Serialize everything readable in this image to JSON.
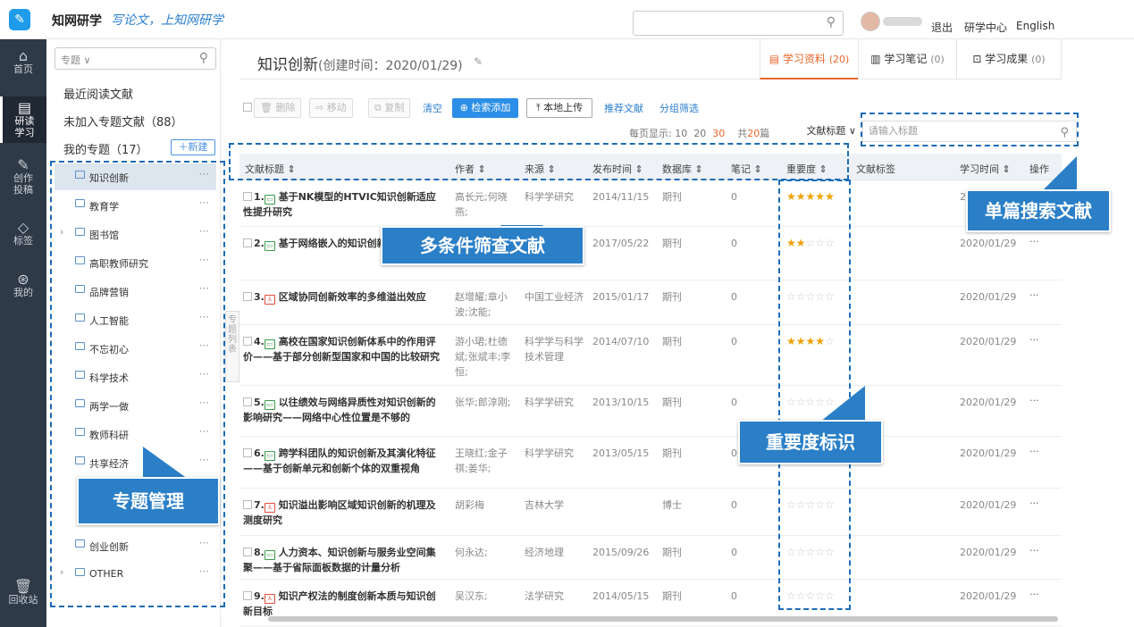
{
  "topbar": {
    "brand": "知网研学",
    "slogan": "写论文，上知网研学",
    "logout": "退出",
    "research_center": "研学中心",
    "language": "English"
  },
  "leftnav": [
    {
      "label": "首页",
      "icon": "home-icon"
    },
    {
      "label": "研读学习",
      "icon": "book-icon"
    },
    {
      "label": "创作投稿",
      "icon": "edit-icon"
    },
    {
      "label": "标签",
      "icon": "tag-icon"
    },
    {
      "label": "我的",
      "icon": "user-icon"
    },
    {
      "label": "回收站",
      "icon": "trash-icon"
    }
  ],
  "sidebar": {
    "search_type": "专题 ∨",
    "recent": "最近阅读文献",
    "unassigned": "未加入专题文献（88）",
    "my_topics": "我的专题（17）",
    "new_button": "＋新建",
    "collapse_handle": "专题列表",
    "folders": [
      "知识创新",
      "教育学",
      "图书馆",
      "高职教师研究",
      "品牌营销",
      "人工智能",
      "不忘初心",
      "科学技术",
      "两学一做",
      "教师科研",
      "共享经济",
      "创业创新",
      "OTHER"
    ],
    "more": "···"
  },
  "header": {
    "title": "知识创新",
    "created": "(创建时间：2020/01/29)",
    "tabs": [
      {
        "label": "学习资料",
        "count": "(20)"
      },
      {
        "label": "学习笔记",
        "count": "(0)"
      },
      {
        "label": "学习成果",
        "count": "(0)"
      }
    ]
  },
  "toolbar": {
    "delete": "删除",
    "move": "移动",
    "copy": "复制",
    "clear": "清空",
    "search_add": "⊕ 检索添加",
    "upload": "⤒ 本地上传",
    "recommend": "推荐文献",
    "group_filter": "分组筛选",
    "per_page_label": "每页显示: ",
    "per_page_options": [
      "10",
      "20",
      "30"
    ],
    "per_page_current": "30",
    "total_prefix": "共",
    "total_count": "20",
    "total_suffix": "篇",
    "field_select": "文献标题 ∨",
    "title_placeholder": "请输入标题"
  },
  "columns": [
    "文献标题 ⇕",
    "作者 ⇕",
    "来源 ⇕",
    "发布时间 ⇕",
    "数据库 ⇕",
    "笔记 ⇕",
    "重要度 ⇕",
    "文献标签",
    "学习时间 ⇕",
    "操作"
  ],
  "rows": [
    {
      "num": "1.",
      "type": "doc",
      "title": "基于NK模型的HTVIC知识创新适应性提升研究",
      "author": "高长元;何晓燕;",
      "source": "科学学研究",
      "date": "2014/11/15",
      "db": "期刊",
      "notes": "0",
      "stars": 5,
      "learn": "2020/01/29"
    },
    {
      "num": "2.",
      "type": "doc",
      "title": "基于网络嵌入的知识创新",
      "author": "",
      "source": "",
      "date": "2017/05/22",
      "db": "期刊",
      "notes": "0",
      "stars": 2,
      "learn": "2020/01/29"
    },
    {
      "num": "3.",
      "type": "pdf",
      "title": "区域协同创新效率的多维溢出效应",
      "author": "赵增耀;章小波;沈能;",
      "source": "中国工业经济",
      "date": "2015/01/17",
      "db": "期刊",
      "notes": "0",
      "stars": 0,
      "learn": "2020/01/29"
    },
    {
      "num": "4.",
      "type": "doc",
      "title": "高校在国家知识创新体系中的作用评价——基于部分创新型国家和中国的比较研究",
      "author": "游小珺;杜德斌;张斌丰;李恒;",
      "source": "科学学与科学技术管理",
      "date": "2014/07/10",
      "db": "期刊",
      "notes": "0",
      "stars": 4,
      "learn": "2020/01/29"
    },
    {
      "num": "5.",
      "type": "doc",
      "title": "以往绩效与网络异质性对知识创新的影响研究——网络中心性位置是不够的",
      "author": "张华;郎淳刚;",
      "source": "科学学研究",
      "date": "2013/10/15",
      "db": "期刊",
      "notes": "0",
      "stars": 0,
      "learn": "2020/01/29"
    },
    {
      "num": "6.",
      "type": "doc",
      "title": "跨学科团队的知识创新及其演化特征——基于创新单元和创新个体的双重视角",
      "author": "王晓红;金子祺;姜华;",
      "source": "科学学研究",
      "date": "2013/05/15",
      "db": "期刊",
      "notes": "0",
      "stars": 0,
      "learn": "2020/01/29"
    },
    {
      "num": "7.",
      "type": "pdf",
      "title": "知识溢出影响区域知识创新的机理及测度研究",
      "author": "胡彩梅",
      "source": "吉林大学",
      "date": "",
      "db": "博士",
      "notes": "0",
      "stars": 0,
      "learn": "2020/01/29"
    },
    {
      "num": "8.",
      "type": "doc",
      "title": "人力资本、知识创新与服务业空间集聚——基于省际面板数据的计量分析",
      "author": "何永达;",
      "source": "经济地理",
      "date": "2015/09/26",
      "db": "期刊",
      "notes": "0",
      "stars": 0,
      "learn": "2020/01/29"
    },
    {
      "num": "9.",
      "type": "pdf",
      "title": "知识产权法的制度创新本质与知识创新目标",
      "author": "吴汉东;",
      "source": "法学研究",
      "date": "2014/05/15",
      "db": "期刊",
      "notes": "0",
      "stars": 0,
      "learn": "2020/01/29"
    }
  ],
  "callouts": {
    "single_search": "单篇搜索文献",
    "multi_filter": "多条件筛查文献",
    "importance": "重要度标识",
    "topic_manage": "专题管理"
  },
  "colors": {
    "accent_orange": "#e9652a",
    "primary_blue": "#2c8ee6",
    "callout_blue": "#2a7fc7",
    "star_gold": "#f0a100",
    "nav_dark": "#2f3a48"
  }
}
